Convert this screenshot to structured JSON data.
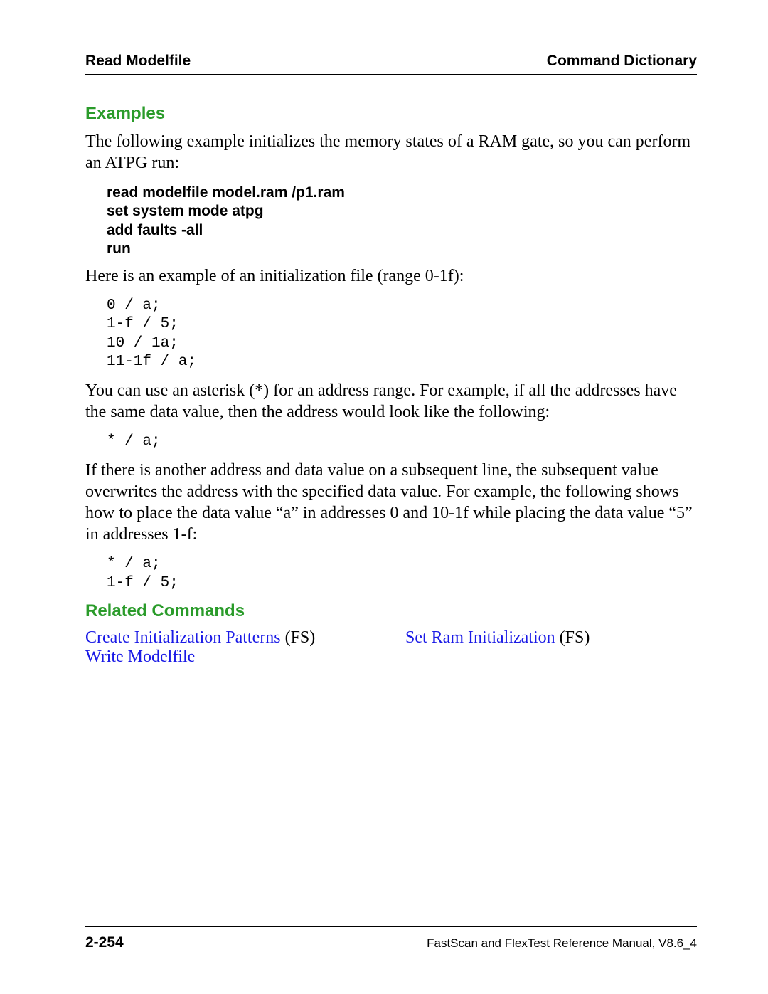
{
  "header": {
    "left": "Read Modelfile",
    "right": "Command Dictionary"
  },
  "sections": {
    "examples_title": "Examples",
    "para1": "The following example initializes the memory states of a RAM gate, so you can perform an ATPG run:",
    "cmd_block": "read modelfile model.ram /p1.ram\nset system mode atpg\nadd faults -all\nrun",
    "para2": "Here is an example of an initialization file (range 0-1f):",
    "mono1": "0 / a;\n1-f / 5;\n10 / 1a;\n11-1f / a;",
    "para3": "You can use an asterisk (*) for an address range. For example, if all the addresses have the same data value, then the address would look like the following:",
    "mono2": "* / a;",
    "para4": "If there is another address and data value on a subsequent line, the subsequent value overwrites the address with the specified data value. For example, the following shows how to place the data value “a” in addresses 0 and 10-1f while placing the data value “5” in addresses 1-f:",
    "mono3": "* / a;\n1-f / 5;",
    "related_title": "Related Commands",
    "related": {
      "link1": "Create Initialization Patterns",
      "suffix1": " (FS)",
      "link2": "Write Modelfile",
      "link3": "Set Ram Initialization",
      "suffix3": " (FS)"
    }
  },
  "footer": {
    "page": "2-254",
    "doc": "FastScan and FlexTest Reference Manual, V8.6_4"
  }
}
